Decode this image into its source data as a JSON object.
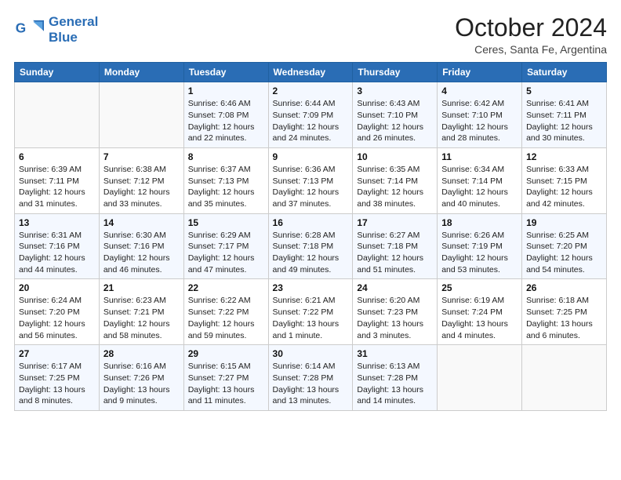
{
  "logo": {
    "line1": "General",
    "line2": "Blue"
  },
  "title": "October 2024",
  "location": "Ceres, Santa Fe, Argentina",
  "days_header": [
    "Sunday",
    "Monday",
    "Tuesday",
    "Wednesday",
    "Thursday",
    "Friday",
    "Saturday"
  ],
  "weeks": [
    [
      {
        "day": "",
        "info": ""
      },
      {
        "day": "",
        "info": ""
      },
      {
        "day": "1",
        "info": "Sunrise: 6:46 AM\nSunset: 7:08 PM\nDaylight: 12 hours and 22 minutes."
      },
      {
        "day": "2",
        "info": "Sunrise: 6:44 AM\nSunset: 7:09 PM\nDaylight: 12 hours and 24 minutes."
      },
      {
        "day": "3",
        "info": "Sunrise: 6:43 AM\nSunset: 7:10 PM\nDaylight: 12 hours and 26 minutes."
      },
      {
        "day": "4",
        "info": "Sunrise: 6:42 AM\nSunset: 7:10 PM\nDaylight: 12 hours and 28 minutes."
      },
      {
        "day": "5",
        "info": "Sunrise: 6:41 AM\nSunset: 7:11 PM\nDaylight: 12 hours and 30 minutes."
      }
    ],
    [
      {
        "day": "6",
        "info": "Sunrise: 6:39 AM\nSunset: 7:11 PM\nDaylight: 12 hours and 31 minutes."
      },
      {
        "day": "7",
        "info": "Sunrise: 6:38 AM\nSunset: 7:12 PM\nDaylight: 12 hours and 33 minutes."
      },
      {
        "day": "8",
        "info": "Sunrise: 6:37 AM\nSunset: 7:13 PM\nDaylight: 12 hours and 35 minutes."
      },
      {
        "day": "9",
        "info": "Sunrise: 6:36 AM\nSunset: 7:13 PM\nDaylight: 12 hours and 37 minutes."
      },
      {
        "day": "10",
        "info": "Sunrise: 6:35 AM\nSunset: 7:14 PM\nDaylight: 12 hours and 38 minutes."
      },
      {
        "day": "11",
        "info": "Sunrise: 6:34 AM\nSunset: 7:14 PM\nDaylight: 12 hours and 40 minutes."
      },
      {
        "day": "12",
        "info": "Sunrise: 6:33 AM\nSunset: 7:15 PM\nDaylight: 12 hours and 42 minutes."
      }
    ],
    [
      {
        "day": "13",
        "info": "Sunrise: 6:31 AM\nSunset: 7:16 PM\nDaylight: 12 hours and 44 minutes."
      },
      {
        "day": "14",
        "info": "Sunrise: 6:30 AM\nSunset: 7:16 PM\nDaylight: 12 hours and 46 minutes."
      },
      {
        "day": "15",
        "info": "Sunrise: 6:29 AM\nSunset: 7:17 PM\nDaylight: 12 hours and 47 minutes."
      },
      {
        "day": "16",
        "info": "Sunrise: 6:28 AM\nSunset: 7:18 PM\nDaylight: 12 hours and 49 minutes."
      },
      {
        "day": "17",
        "info": "Sunrise: 6:27 AM\nSunset: 7:18 PM\nDaylight: 12 hours and 51 minutes."
      },
      {
        "day": "18",
        "info": "Sunrise: 6:26 AM\nSunset: 7:19 PM\nDaylight: 12 hours and 53 minutes."
      },
      {
        "day": "19",
        "info": "Sunrise: 6:25 AM\nSunset: 7:20 PM\nDaylight: 12 hours and 54 minutes."
      }
    ],
    [
      {
        "day": "20",
        "info": "Sunrise: 6:24 AM\nSunset: 7:20 PM\nDaylight: 12 hours and 56 minutes."
      },
      {
        "day": "21",
        "info": "Sunrise: 6:23 AM\nSunset: 7:21 PM\nDaylight: 12 hours and 58 minutes."
      },
      {
        "day": "22",
        "info": "Sunrise: 6:22 AM\nSunset: 7:22 PM\nDaylight: 12 hours and 59 minutes."
      },
      {
        "day": "23",
        "info": "Sunrise: 6:21 AM\nSunset: 7:22 PM\nDaylight: 13 hours and 1 minute."
      },
      {
        "day": "24",
        "info": "Sunrise: 6:20 AM\nSunset: 7:23 PM\nDaylight: 13 hours and 3 minutes."
      },
      {
        "day": "25",
        "info": "Sunrise: 6:19 AM\nSunset: 7:24 PM\nDaylight: 13 hours and 4 minutes."
      },
      {
        "day": "26",
        "info": "Sunrise: 6:18 AM\nSunset: 7:25 PM\nDaylight: 13 hours and 6 minutes."
      }
    ],
    [
      {
        "day": "27",
        "info": "Sunrise: 6:17 AM\nSunset: 7:25 PM\nDaylight: 13 hours and 8 minutes."
      },
      {
        "day": "28",
        "info": "Sunrise: 6:16 AM\nSunset: 7:26 PM\nDaylight: 13 hours and 9 minutes."
      },
      {
        "day": "29",
        "info": "Sunrise: 6:15 AM\nSunset: 7:27 PM\nDaylight: 13 hours and 11 minutes."
      },
      {
        "day": "30",
        "info": "Sunrise: 6:14 AM\nSunset: 7:28 PM\nDaylight: 13 hours and 13 minutes."
      },
      {
        "day": "31",
        "info": "Sunrise: 6:13 AM\nSunset: 7:28 PM\nDaylight: 13 hours and 14 minutes."
      },
      {
        "day": "",
        "info": ""
      },
      {
        "day": "",
        "info": ""
      }
    ]
  ]
}
